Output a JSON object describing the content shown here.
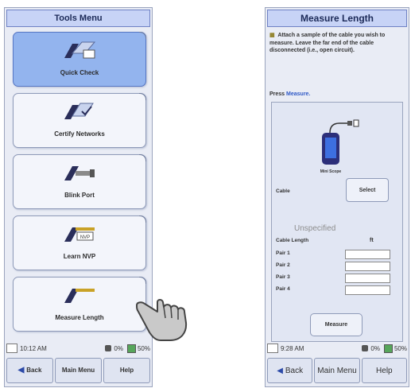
{
  "left_screen": {
    "title": "Tools Menu",
    "items": [
      {
        "label": "Quick Check"
      },
      {
        "label": "Certify Networks"
      },
      {
        "label": "Blink Port"
      },
      {
        "label": "Learn NVP"
      },
      {
        "label": "Measure Length"
      }
    ],
    "status": {
      "time": "10:12 AM",
      "power": "0%",
      "battery": "50%"
    },
    "softkeys": {
      "back": "Back",
      "main_menu": "Main Menu",
      "help": "Help"
    }
  },
  "right_screen": {
    "title": "Measure Length",
    "instructions": "Attach a sample of the cable you wish to measure. Leave the far end of the cable disconnected (i.e., open circuit).",
    "press_prefix": "Press",
    "press_link": "Measure.",
    "device_label": "Mini Scope",
    "cable_label": "Cable",
    "select_label": "Select",
    "cable_value": "Unspecified",
    "cable_length_label": "Cable Length",
    "unit": "ft",
    "pairs": [
      "Pair 1",
      "Pair 2",
      "Pair 3",
      "Pair 4"
    ],
    "measure_label": "Measure",
    "status": {
      "time": "9:28 AM",
      "power": "0%",
      "battery": "50%"
    },
    "softkeys": {
      "back": "Back",
      "main_menu": "Main Menu",
      "help": "Help"
    }
  },
  "colors": {
    "accent": "#93b4ee",
    "titlebar": "#c7d3f6",
    "link": "#2e58c6"
  }
}
